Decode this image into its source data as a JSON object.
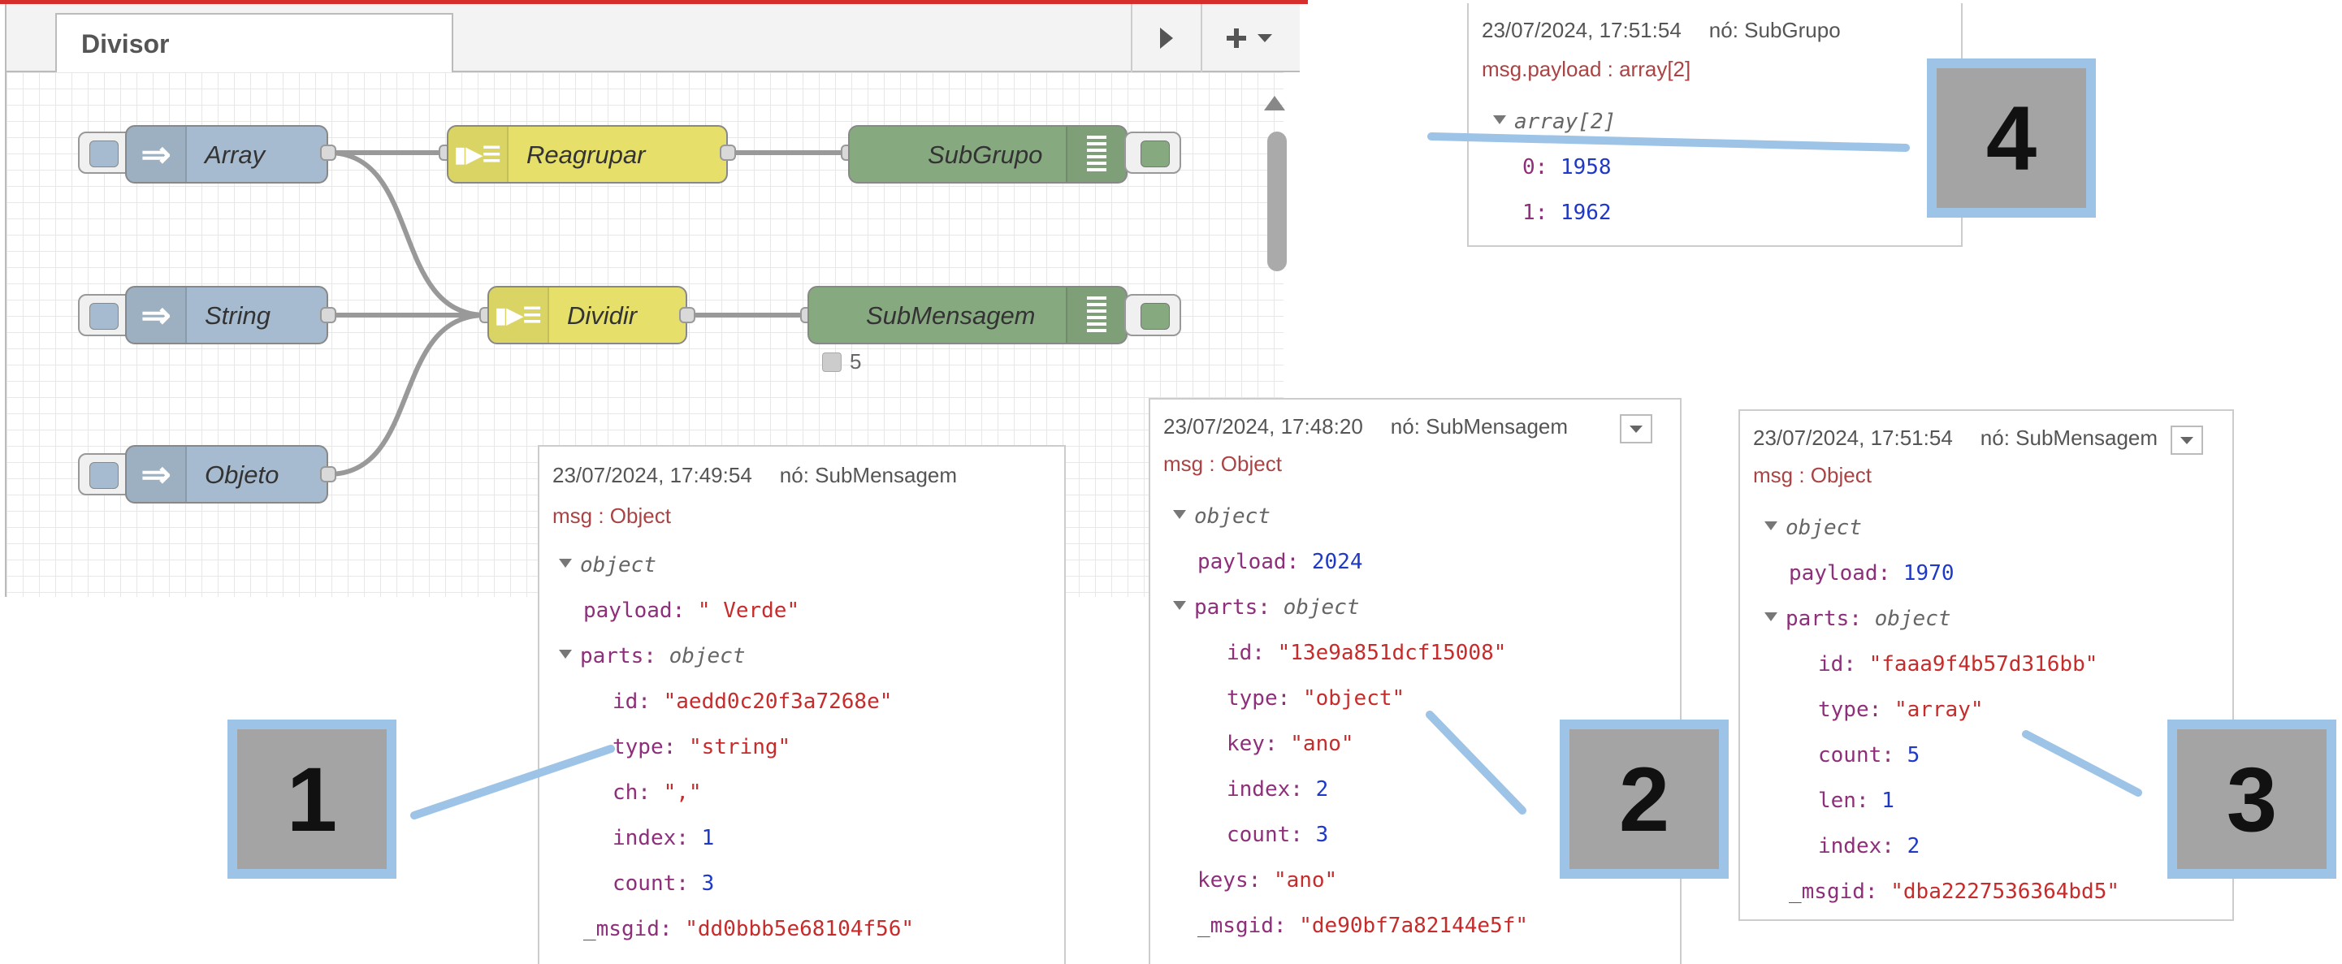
{
  "editor": {
    "tab_label": "Divisor",
    "nodes": [
      {
        "label": "Array"
      },
      {
        "label": "String"
      },
      {
        "label": "Objeto"
      },
      {
        "label": "Reagrupar"
      },
      {
        "label": "Dividir"
      },
      {
        "label": "SubGrupo"
      },
      {
        "label": "SubMensagem"
      }
    ],
    "status_count": "5"
  },
  "panels": {
    "p1": {
      "timestamp": "23/07/2024, 17:49:54",
      "node": "nó: SubMensagem",
      "topic": "msg : Object",
      "root": "object",
      "rows": [
        {
          "key": "payload:",
          "val": "\" Verde\""
        },
        {
          "key": "parts:",
          "val": "object"
        },
        {
          "key": "id:",
          "val": "\"aedd0c20f3a7268e\""
        },
        {
          "key": "type:",
          "val": "\"string\""
        },
        {
          "key": "ch:",
          "val": "\",\""
        },
        {
          "key": "index:",
          "val": "1"
        },
        {
          "key": "count:",
          "val": "3"
        },
        {
          "key": "_msgid:",
          "val": "\"dd0bbb5e68104f56\""
        }
      ]
    },
    "p2": {
      "timestamp": "23/07/2024, 17:48:20",
      "node": "nó: SubMensagem",
      "topic": "msg : Object",
      "root": "object",
      "rows": [
        {
          "key": "payload:",
          "val": "2024"
        },
        {
          "key": "parts:",
          "val": "object"
        },
        {
          "key": "id:",
          "val": "\"13e9a851dcf15008\""
        },
        {
          "key": "type:",
          "val": "\"object\""
        },
        {
          "key": "key:",
          "val": "\"ano\""
        },
        {
          "key": "index:",
          "val": "2"
        },
        {
          "key": "count:",
          "val": "3"
        },
        {
          "key": "keys:",
          "val": "\"ano\""
        },
        {
          "key": "_msgid:",
          "val": "\"de90bf7a82144e5f\""
        }
      ]
    },
    "p3": {
      "timestamp": "23/07/2024, 17:51:54",
      "node": "nó: SubMensagem",
      "topic": "msg : Object",
      "root": "object",
      "rows": [
        {
          "key": "payload:",
          "val": "1970"
        },
        {
          "key": "parts:",
          "val": "object"
        },
        {
          "key": "id:",
          "val": "\"faaa9f4b57d316bb\""
        },
        {
          "key": "type:",
          "val": "\"array\""
        },
        {
          "key": "count:",
          "val": "5"
        },
        {
          "key": "len:",
          "val": "1"
        },
        {
          "key": "index:",
          "val": "2"
        },
        {
          "key": "_msgid:",
          "val": "\"dba2227536364bd5\""
        }
      ]
    },
    "p4": {
      "timestamp": "23/07/2024, 17:51:54",
      "node": "nó: SubGrupo",
      "topic": "msg.payload : array[2]",
      "root": "array[2]",
      "rows": [
        {
          "key": "0:",
          "val": "1958"
        },
        {
          "key": "1:",
          "val": "1962"
        }
      ]
    }
  },
  "callouts": [
    "1",
    "2",
    "3",
    "4"
  ],
  "colors": {
    "callout_border": "#9dc3e6",
    "callout_fill": "#a4a4a4",
    "inject_node": "#a6bbcf",
    "function_node": "#e6e06a",
    "debug_node": "#87a980",
    "string_value": "#c62c2c",
    "number_value": "#1f39c7",
    "key": "#8d2f7a"
  },
  "icons": [
    "arrow-right-icon",
    "split-icon",
    "list-icon",
    "play-icon",
    "plus-icon",
    "chevron-down-icon"
  ]
}
